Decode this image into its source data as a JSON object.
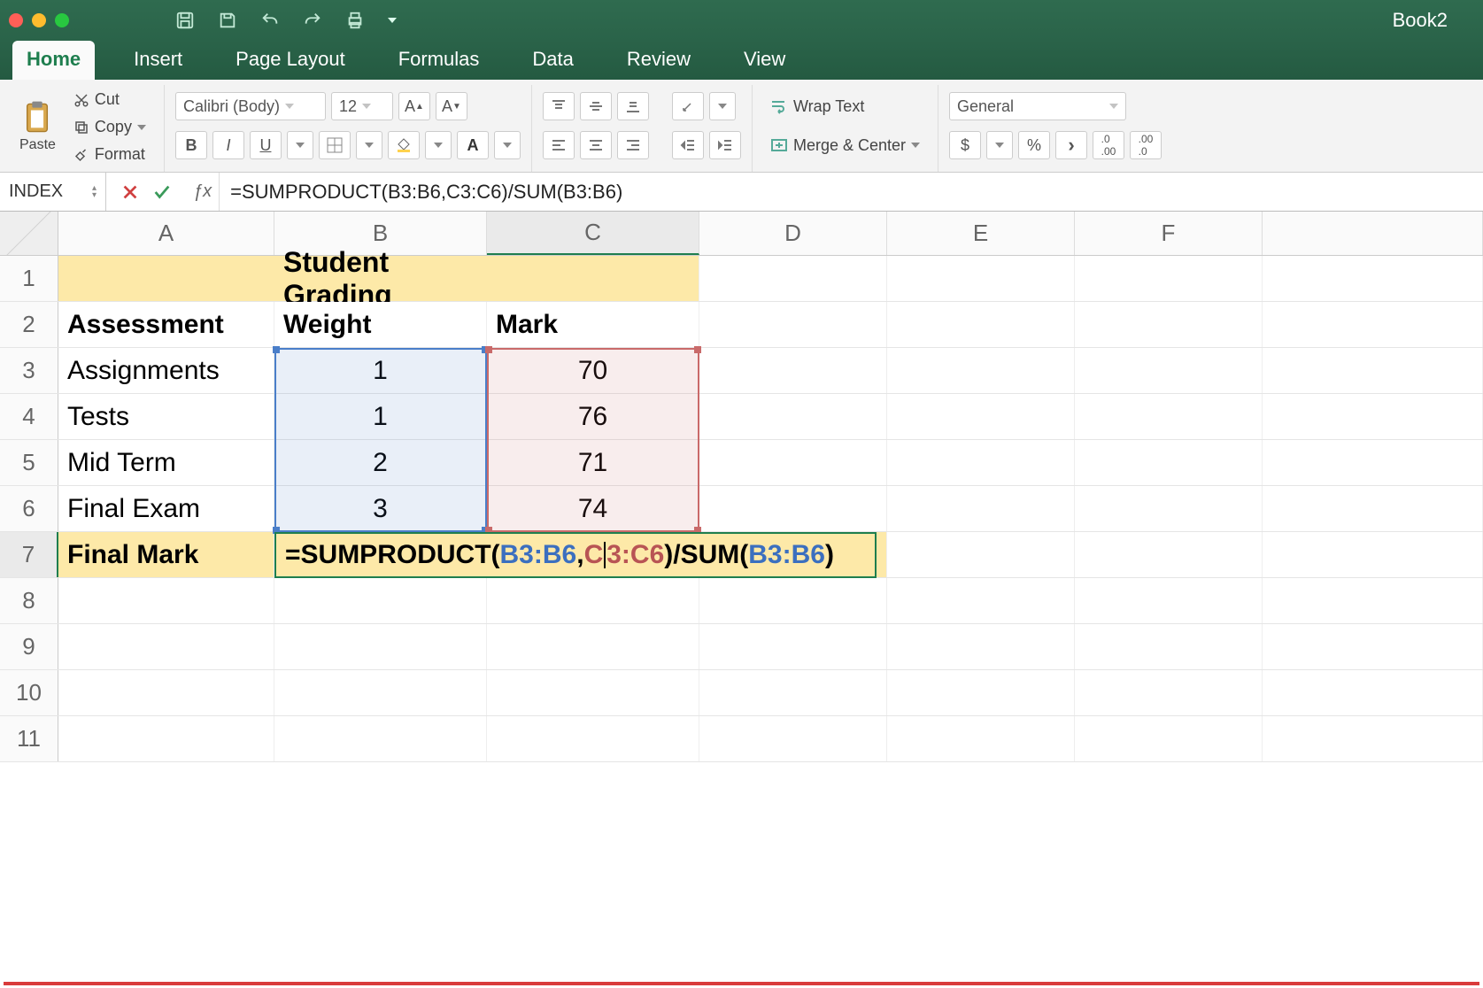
{
  "window": {
    "title": "Book2"
  },
  "tabs": [
    "Home",
    "Insert",
    "Page Layout",
    "Formulas",
    "Data",
    "Review",
    "View"
  ],
  "active_tab": 0,
  "clipboard": {
    "paste": "Paste",
    "cut": "Cut",
    "copy": "Copy",
    "format": "Format"
  },
  "font": {
    "name": "Calibri (Body)",
    "size": "12",
    "bold": "B",
    "italic": "I",
    "underline": "U"
  },
  "align": {
    "wrap": "Wrap Text",
    "merge": "Merge & Center"
  },
  "number": {
    "format": "General",
    "currency": "$",
    "percent": "%"
  },
  "namebox": "INDEX",
  "formula": "=SUMPRODUCT(B3:B6,C3:C6)/SUM(B3:B6)",
  "columns": [
    "A",
    "B",
    "C",
    "D",
    "E",
    "F"
  ],
  "rows": [
    "1",
    "2",
    "3",
    "4",
    "5",
    "6",
    "7",
    "8",
    "9",
    "10",
    "11"
  ],
  "sheet": {
    "title": "Student Grading",
    "headers": {
      "a": "Assessment",
      "b": "Weight",
      "c": "Mark"
    },
    "data": [
      {
        "a": "Assignments",
        "b": "1",
        "c": "70"
      },
      {
        "a": "Tests",
        "b": "1",
        "c": "76"
      },
      {
        "a": "Mid Term",
        "b": "2",
        "c": "71"
      },
      {
        "a": "Final Exam",
        "b": "3",
        "c": "74"
      }
    ],
    "final_label": "Final Mark",
    "formula_tokens": {
      "p1": "=SUMPRODUCT(",
      "r1": "B3:B6",
      "comma": ",",
      "r2a": "C",
      "r2b": "3:C6",
      "p2": ")/SUM(",
      "r3": "B3:B6",
      "p3": ")"
    }
  },
  "chart_data": {
    "type": "table",
    "title": "Student Grading",
    "columns": [
      "Assessment",
      "Weight",
      "Mark"
    ],
    "rows": [
      [
        "Assignments",
        1,
        70
      ],
      [
        "Tests",
        1,
        76
      ],
      [
        "Mid Term",
        2,
        71
      ],
      [
        "Final Exam",
        3,
        74
      ]
    ],
    "formula": "=SUMPRODUCT(B3:B6,C3:C6)/SUM(B3:B6)"
  }
}
